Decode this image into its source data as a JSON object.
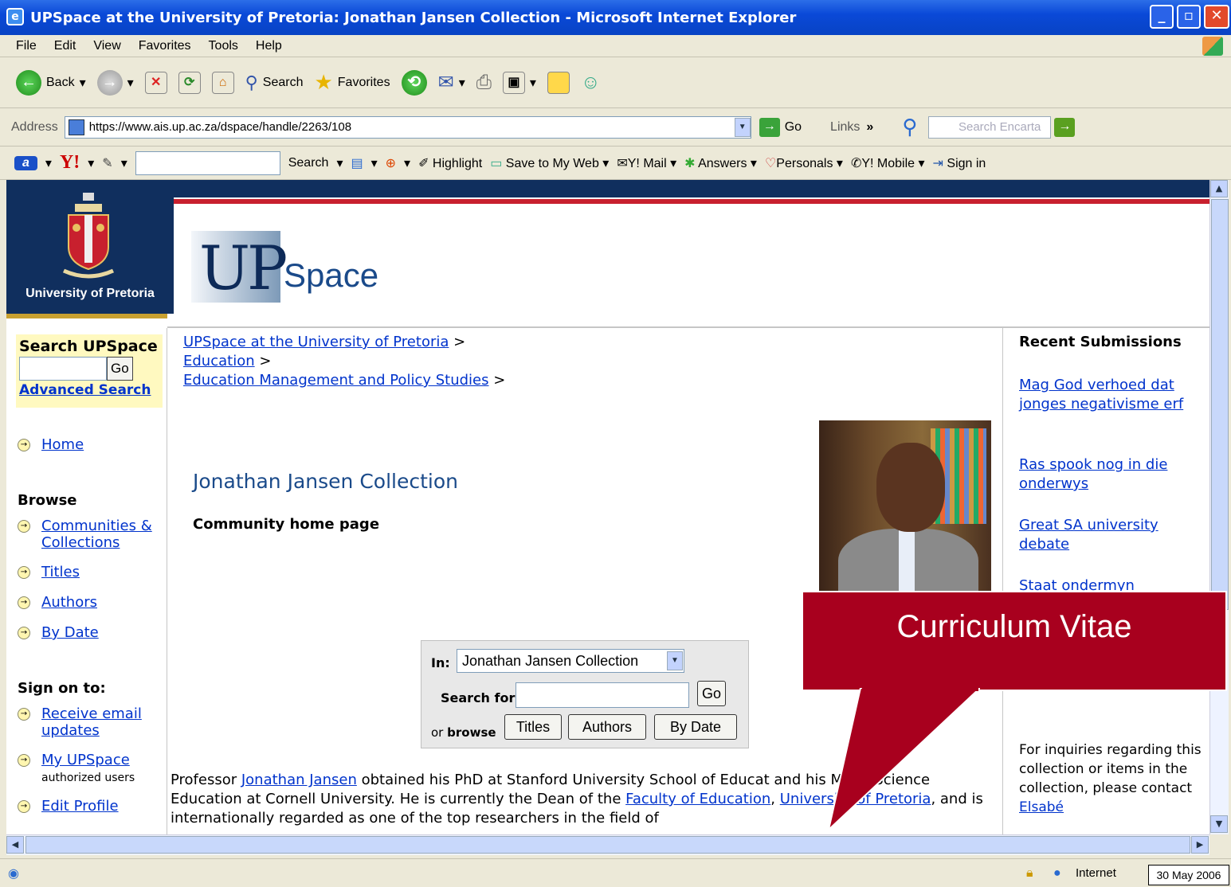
{
  "window": {
    "title": "UPSpace at the University of Pretoria: Jonathan Jansen Collection - Microsoft Internet Explorer"
  },
  "menu": [
    "File",
    "Edit",
    "View",
    "Favorites",
    "Tools",
    "Help"
  ],
  "toolbar": {
    "back": "Back",
    "search": "Search",
    "favorites": "Favorites"
  },
  "address": {
    "label": "Address",
    "url": "https://www.ais.up.ac.za/dspace/handle/2263/108",
    "go": "Go",
    "links": "Links",
    "encarta_placeholder": "Search Encarta"
  },
  "yahoo_toolbar": {
    "search": "Search",
    "highlight": "Highlight",
    "save": "Save to My Web",
    "mail": "Y! Mail",
    "answers": "Answers",
    "personals": "Personals",
    "mobile": "Y! Mobile",
    "signin": "Sign in"
  },
  "header": {
    "university": "University of Pretoria",
    "logo_up": "UP",
    "logo_space": "Space"
  },
  "sidebar": {
    "search_title": "Search UPSpace",
    "go": "Go",
    "advanced": "Advanced Search",
    "home": "Home",
    "browse_title": "Browse",
    "browse": [
      "Communities & Collections",
      "Titles",
      "Authors",
      "By Date"
    ],
    "signon_title": "Sign on to:",
    "receive": "Receive email updates",
    "myupspace": "My UPSpace",
    "authorized": "authorized users",
    "edit": "Edit Profile"
  },
  "breadcrumb": [
    "UPSpace at the University of Pretoria",
    "Education",
    "Education Management and Policy Studies"
  ],
  "main": {
    "title": "Jonathan Jansen Collection",
    "subtitle": "Community home page",
    "search_in_label": "In:",
    "search_in_value": "Jonathan Jansen Collection",
    "search_for_label": "Search for",
    "go": "Go",
    "or": "or",
    "browse": "browse",
    "browse_titles": "Titles",
    "browse_authors": "Authors",
    "browse_date": "By Date",
    "para_1": "Professor ",
    "para_link1": "Jonathan Jansen",
    "para_2": " obtained his PhD at Stanford University School of Educat",
    "para_3": "and his MS in Science Education at Cornell University. He is currently the Dean of the ",
    "para_link2": "Faculty of Education",
    "para_4": ", ",
    "para_link3": "University of Pretoria",
    "para_5": ", and is internationally regarded as one of the top researchers in the field of"
  },
  "recent": {
    "title": "Recent Submissions",
    "items": [
      "Mag God verhoed dat jonges negativisme erf",
      "Ras spook nog in die onderwys",
      "Great SA university debate",
      "Staat ondermyn"
    ],
    "inquiries": "For inquiries regarding this collection or items in the collection, please contact ",
    "contact": "Elsabé"
  },
  "callout": {
    "text": "Curriculum Vitae"
  },
  "status": {
    "zone": "Internet",
    "date": "30 May 2006"
  }
}
